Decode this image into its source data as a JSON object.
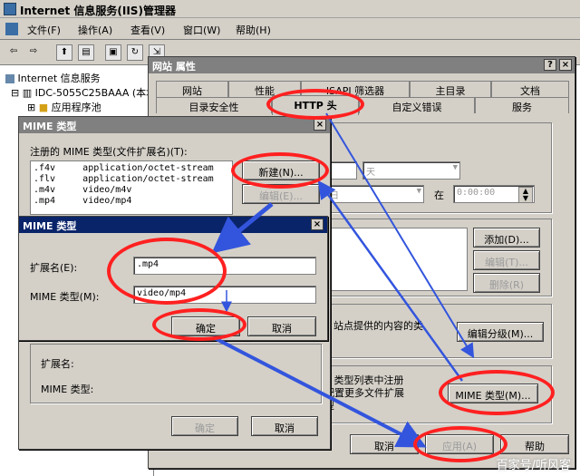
{
  "app": {
    "title": "Internet 信息服务(IIS)管理器",
    "menu": [
      "文件(F)",
      "操作(A)",
      "查看(V)",
      "窗口(W)",
      "帮助(H)"
    ]
  },
  "tree": {
    "root": "Internet 信息服务",
    "server": "IDC-5055C25BAAA (本地",
    "app_pools": "应用程序池"
  },
  "site_props": {
    "title": "网站 属性",
    "tabs_row1": [
      "网站",
      "性能",
      "ISAPI 筛选器",
      "主目录",
      "文档"
    ],
    "tabs_row2": [
      "目录安全性",
      "HTTP 头",
      "自定义错误",
      "服务"
    ],
    "time_value": "0:00:00",
    "at_label": "在",
    "add_button": "添加(D)...",
    "edit_button": "编辑(T)...",
    "delete_button": "删除(R)",
    "content_rating_text": "站点提供的内容的类",
    "edit_rating_button": "编辑分级(M)...",
    "mime_text_1": "E 类型列表中注册",
    "mime_text_2": "配置更多文件扩展",
    "mime_text_3": "型",
    "mime_types_button": "MIME 类型(M)...",
    "cancel_button": "取消",
    "apply_button": "应用(A)",
    "help_button": "帮助"
  },
  "mime_list_dialog": {
    "title": "MIME 类型",
    "registered_label": "注册的 MIME 类型(文件扩展名)(T):",
    "entries": [
      ".f4v     application/octet-stream",
      ".flv     application/octet-stream",
      ".m4v     video/m4v",
      ".mp4     video/mp4"
    ],
    "new_button": "新建(N)...",
    "edit_button": "编辑(E)...",
    "ext_label": "扩展名:",
    "mime_label": "MIME 类型:",
    "ok_button": "确定",
    "cancel_button": "取消"
  },
  "mime_edit_dialog": {
    "title": "MIME 类型",
    "ext_label": "扩展名(E):",
    "ext_value": ".mp4",
    "mime_label": "MIME 类型(M):",
    "mime_value": "video/mp4",
    "ok_button": "确定",
    "cancel_button": "取消"
  },
  "watermark": "百家号/听风客"
}
